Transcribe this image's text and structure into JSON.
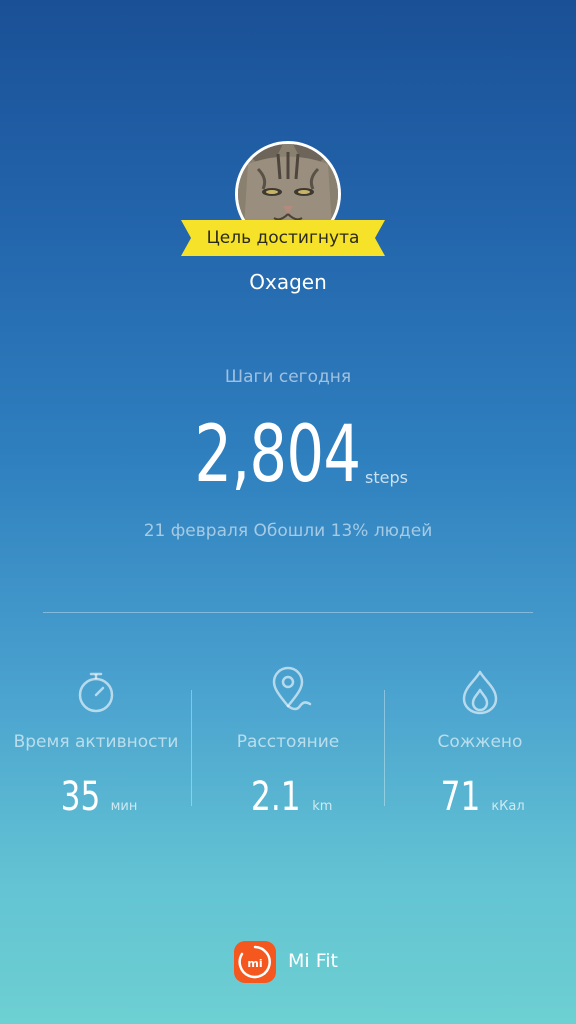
{
  "profile": {
    "goal_badge": "Цель достигнута",
    "username": "Oxagen"
  },
  "steps": {
    "title": "Шаги сегодня",
    "value": "2,804",
    "unit": "steps",
    "subtitle": "21 февраля Обошли 13% людей"
  },
  "stats": [
    {
      "icon": "stopwatch-icon",
      "label": "Время активности",
      "value": "35",
      "unit": "мин"
    },
    {
      "icon": "location-pin-icon",
      "label": "Расстояние",
      "value": "2.1",
      "unit": "km"
    },
    {
      "icon": "flame-icon",
      "label": "Сожжено",
      "value": "71",
      "unit": "кКал"
    }
  ],
  "footer": {
    "logo_text": "mi",
    "app_name": "Mi Fit"
  },
  "colors": {
    "ribbon": "#f6e228",
    "accent_logo": "#f4581f"
  }
}
